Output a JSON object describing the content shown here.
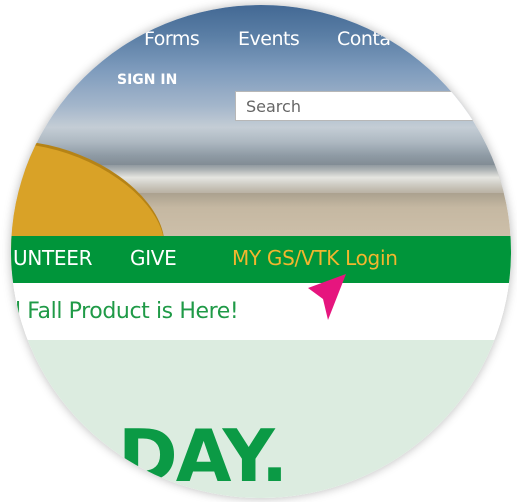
{
  "header": {
    "nav": {
      "forms": "Forms",
      "events": "Events",
      "contact": "Conta"
    },
    "sign_in": "SIGN IN",
    "search": {
      "placeholder": "Search"
    }
  },
  "green_nav": {
    "volunteer": "UNTEER",
    "give": "GIVE",
    "login": "MY GS/VTK Login"
  },
  "announcement": {
    "text": "l Fall Product is Here!"
  },
  "hero_text": {
    "headline": "DAY."
  },
  "colors": {
    "brand_green": "#00953a",
    "login_gold": "#f2b62e",
    "cursor_magenta": "#e6157e",
    "light_green_bg": "#dcece0"
  },
  "icons": {
    "pointer": "magenta-arrow-cursor-icon"
  }
}
